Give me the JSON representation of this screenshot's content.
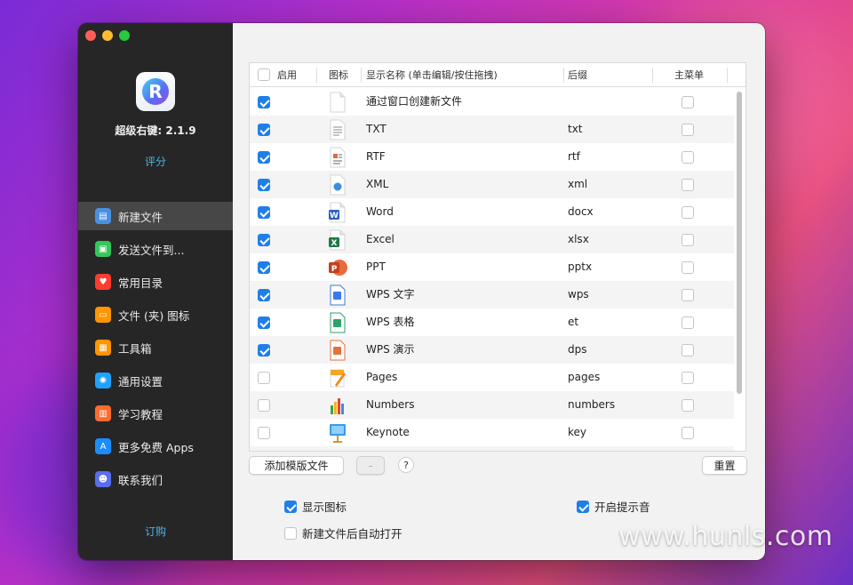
{
  "app": {
    "version_label": "超级右键: 2.1.9",
    "rate_label": "评分",
    "subscribe_label": "订购"
  },
  "sidebar": {
    "items": [
      {
        "label": "新建文件",
        "icon": "new-file-icon",
        "color": "#4a90e2",
        "active": true
      },
      {
        "label": "发送文件到...",
        "icon": "send-file-icon",
        "color": "#34c759",
        "active": false
      },
      {
        "label": "常用目录",
        "icon": "heart-icon",
        "color": "#ff3b30",
        "active": false
      },
      {
        "label": "文件 (夹) 图标",
        "icon": "folder-icon-icon",
        "color": "#ff9500",
        "active": false
      },
      {
        "label": "工具箱",
        "icon": "toolbox-icon",
        "color": "#ff9500",
        "active": false
      },
      {
        "label": "通用设置",
        "icon": "gear-icon",
        "color": "#1fa2ff",
        "active": false
      },
      {
        "label": "学习教程",
        "icon": "book-icon",
        "color": "#ff6b2c",
        "active": false
      },
      {
        "label": "更多免费 Apps",
        "icon": "app-store-icon",
        "color": "#1a8cff",
        "active": false
      },
      {
        "label": "联系我们",
        "icon": "contacts-icon",
        "color": "#5a6cf0",
        "active": false
      }
    ]
  },
  "table": {
    "headers": {
      "enabled": "启用",
      "icon": "图标",
      "name": "显示名称 (单击编辑/按住拖拽)",
      "ext": "后缀",
      "main_menu": "主菜单"
    },
    "rows": [
      {
        "enabled": true,
        "icon": "blank-doc-icon",
        "name": "通过窗口创建新文件",
        "ext": "",
        "main_menu": false
      },
      {
        "enabled": true,
        "icon": "txt-doc-icon",
        "name": "TXT",
        "ext": "txt",
        "main_menu": false
      },
      {
        "enabled": true,
        "icon": "rtf-doc-icon",
        "name": "RTF",
        "ext": "rtf",
        "main_menu": false
      },
      {
        "enabled": true,
        "icon": "xml-doc-icon",
        "name": "XML",
        "ext": "xml",
        "main_menu": false
      },
      {
        "enabled": true,
        "icon": "word-icon",
        "name": "Word",
        "ext": "docx",
        "main_menu": false
      },
      {
        "enabled": true,
        "icon": "excel-icon",
        "name": "Excel",
        "ext": "xlsx",
        "main_menu": false
      },
      {
        "enabled": true,
        "icon": "powerpoint-icon",
        "name": "PPT",
        "ext": "pptx",
        "main_menu": false
      },
      {
        "enabled": true,
        "icon": "wps-writer-icon",
        "name": "WPS 文字",
        "ext": "wps",
        "main_menu": false
      },
      {
        "enabled": true,
        "icon": "wps-sheet-icon",
        "name": "WPS 表格",
        "ext": "et",
        "main_menu": false
      },
      {
        "enabled": true,
        "icon": "wps-presentation-icon",
        "name": "WPS 演示",
        "ext": "dps",
        "main_menu": false
      },
      {
        "enabled": false,
        "icon": "pages-icon",
        "name": "Pages",
        "ext": "pages",
        "main_menu": false
      },
      {
        "enabled": false,
        "icon": "numbers-icon",
        "name": "Numbers",
        "ext": "numbers",
        "main_menu": false
      },
      {
        "enabled": false,
        "icon": "keynote-icon",
        "name": "Keynote",
        "ext": "key",
        "main_menu": false
      },
      {
        "enabled": false,
        "icon": "partial-row-icon",
        "name": "",
        "ext": "",
        "main_menu": false
      }
    ]
  },
  "buttons": {
    "add_template": "添加模版文件",
    "remove": "-",
    "help": "?",
    "reset": "重置"
  },
  "options": {
    "show_icon": {
      "label": "显示图标",
      "checked": true
    },
    "sound": {
      "label": "开启提示音",
      "checked": true
    },
    "auto_open": {
      "label": "新建文件后自动打开",
      "checked": false
    }
  },
  "watermark": "www.hunls.com"
}
